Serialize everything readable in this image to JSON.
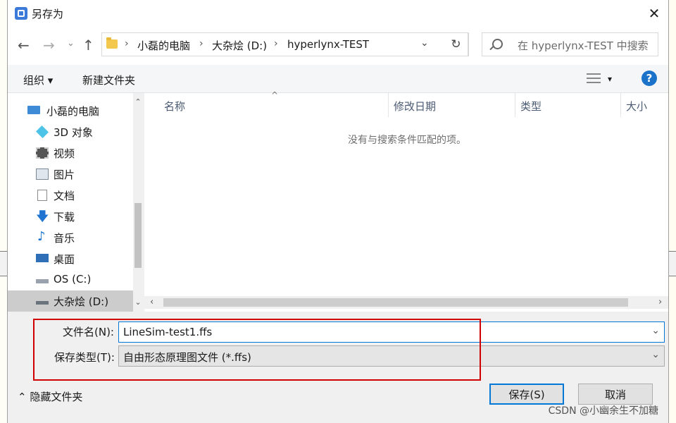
{
  "dialog": {
    "title": "另存为",
    "close": "✕"
  },
  "nav": {
    "back": "←",
    "forward": "→",
    "recent": "⌄",
    "up": "↑",
    "refresh": "↻"
  },
  "address": {
    "crumbs": [
      "小磊的电脑",
      "大杂烩 (D:)",
      "hyperlynx-TEST"
    ],
    "separator": "›",
    "dropdown": "⌄"
  },
  "search": {
    "placeholder": "在 hyperlynx-TEST 中搜索"
  },
  "toolbar": {
    "organize": "组织 ▾",
    "new_folder": "新建文件夹",
    "view_dropdown": "▾",
    "help": "?"
  },
  "sidebar": {
    "items": [
      {
        "label": "小磊的电脑",
        "icon": "computer-icon"
      },
      {
        "label": "3D 对象",
        "icon": "cube-icon"
      },
      {
        "label": "视频",
        "icon": "video-icon"
      },
      {
        "label": "图片",
        "icon": "picture-icon"
      },
      {
        "label": "文档",
        "icon": "document-icon"
      },
      {
        "label": "下载",
        "icon": "download-icon"
      },
      {
        "label": "音乐",
        "icon": "music-icon"
      },
      {
        "label": "桌面",
        "icon": "desktop-icon"
      },
      {
        "label": "OS (C:)",
        "icon": "drive-icon"
      },
      {
        "label": "大杂烩 (D:)",
        "icon": "drive-icon"
      }
    ],
    "scroll_up": "⌃",
    "scroll_down": "⌄"
  },
  "filelist": {
    "columns": [
      "名称",
      "修改日期",
      "类型",
      "大小"
    ],
    "sort_caret": "^",
    "empty_message": "没有与搜索条件匹配的项。",
    "scroll_left": "‹",
    "scroll_right": "›"
  },
  "save": {
    "filename_label": "文件名(N):",
    "filename_value": "LineSim-test1.ffs",
    "type_label": "保存类型(T):",
    "type_value": "自由形态原理图文件 (*.ffs)",
    "dropdown": "⌄",
    "hide_folders": "⌃  隐藏文件夹",
    "save_button": "保存(S)",
    "cancel_button": "取消"
  },
  "watermark": "CSDN @小幽余生不加糖",
  "colors": {
    "accent": "#0078d7",
    "highlight_frame": "#d00000"
  }
}
